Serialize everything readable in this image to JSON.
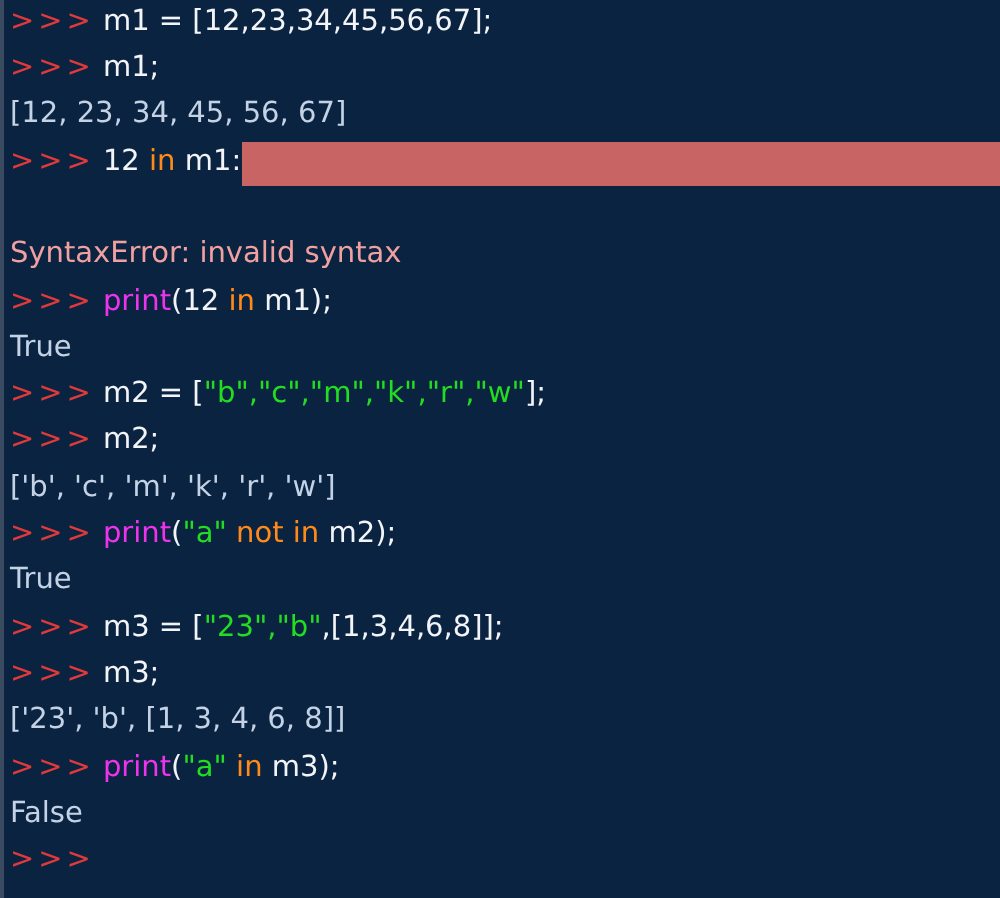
{
  "shell": {
    "lines": [
      {
        "kind": "input",
        "prompt": ">>>",
        "tokens": [
          {
            "kind": "plain",
            "text": "m1 = [12,23,34,45,56,67];"
          }
        ]
      },
      {
        "kind": "input",
        "prompt": ">>>",
        "tokens": [
          {
            "kind": "plain",
            "text": "m1;"
          }
        ]
      },
      {
        "kind": "output",
        "text": "[12, 23, 34, 45, 56, 67]"
      },
      {
        "kind": "input",
        "prompt": ">>>",
        "error_highlight": true,
        "tokens": [
          {
            "kind": "plain",
            "text": "12 "
          },
          {
            "kind": "keyword",
            "text": "in"
          },
          {
            "kind": "plain",
            "text": " m1:"
          }
        ]
      },
      {
        "kind": "blank"
      },
      {
        "kind": "error",
        "text": "SyntaxError: invalid syntax"
      },
      {
        "kind": "input",
        "prompt": ">>>",
        "tokens": [
          {
            "kind": "builtin",
            "text": "print"
          },
          {
            "kind": "plain",
            "text": "(12 "
          },
          {
            "kind": "keyword",
            "text": "in"
          },
          {
            "kind": "plain",
            "text": " m1);"
          }
        ]
      },
      {
        "kind": "output",
        "text": "True"
      },
      {
        "kind": "input",
        "prompt": ">>>",
        "tokens": [
          {
            "kind": "plain",
            "text": "m2 = ["
          },
          {
            "kind": "string",
            "text": "\"b\","
          },
          {
            "kind": "string",
            "text": "\"c\","
          },
          {
            "kind": "string",
            "text": "\"m\","
          },
          {
            "kind": "string",
            "text": "\"k\","
          },
          {
            "kind": "string",
            "text": "\"r\","
          },
          {
            "kind": "string",
            "text": "\"w\""
          },
          {
            "kind": "plain",
            "text": "];"
          }
        ]
      },
      {
        "kind": "input",
        "prompt": ">>>",
        "tokens": [
          {
            "kind": "plain",
            "text": "m2;"
          }
        ]
      },
      {
        "kind": "output",
        "text": "['b', 'c', 'm', 'k', 'r', 'w']"
      },
      {
        "kind": "input",
        "prompt": ">>>",
        "tokens": [
          {
            "kind": "builtin",
            "text": "print"
          },
          {
            "kind": "plain",
            "text": "("
          },
          {
            "kind": "string",
            "text": "\"a\""
          },
          {
            "kind": "keyword",
            "text": " not in"
          },
          {
            "kind": "plain",
            "text": " m2);"
          }
        ]
      },
      {
        "kind": "output",
        "text": "True"
      },
      {
        "kind": "input",
        "prompt": ">>>",
        "tokens": [
          {
            "kind": "plain",
            "text": "m3 = ["
          },
          {
            "kind": "string",
            "text": "\"23\","
          },
          {
            "kind": "string",
            "text": "\"b\""
          },
          {
            "kind": "plain",
            "text": ",[1,3,4,6,8]];"
          }
        ]
      },
      {
        "kind": "input",
        "prompt": ">>>",
        "tokens": [
          {
            "kind": "plain",
            "text": "m3;"
          }
        ]
      },
      {
        "kind": "output",
        "text": "['23', 'b', [1, 3, 4, 6, 8]]"
      },
      {
        "kind": "input",
        "prompt": ">>>",
        "tokens": [
          {
            "kind": "builtin",
            "text": "print"
          },
          {
            "kind": "plain",
            "text": "("
          },
          {
            "kind": "string",
            "text": "\"a\""
          },
          {
            "kind": "keyword",
            "text": " in"
          },
          {
            "kind": "plain",
            "text": " m3);"
          }
        ]
      },
      {
        "kind": "output",
        "text": "False"
      },
      {
        "kind": "input",
        "prompt": ">>>"
      }
    ]
  }
}
